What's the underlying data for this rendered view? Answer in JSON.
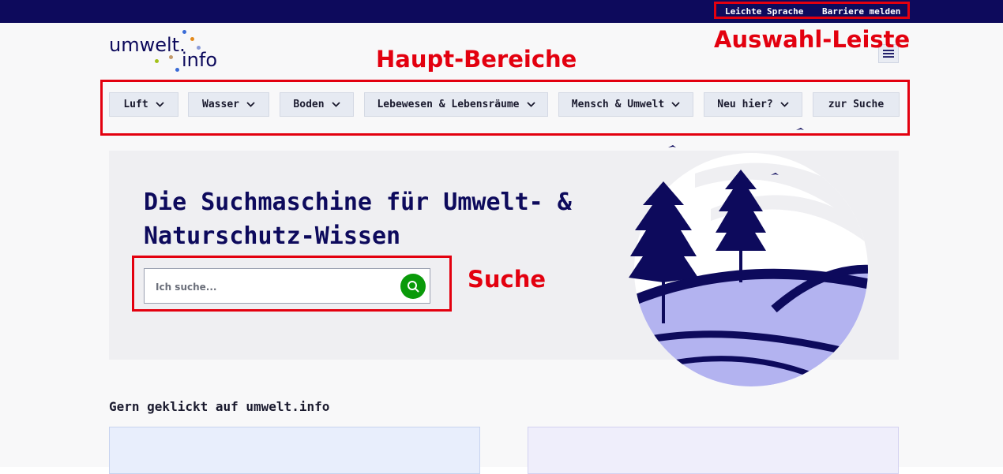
{
  "topbar": {
    "easy_language": "Leichte Sprache",
    "report_barrier": "Barriere melden"
  },
  "annotations": {
    "selection_bar": "Auswahl-Leiste",
    "main_areas": "Haupt-Bereiche",
    "search": "Suche"
  },
  "logo": {
    "word1": "umwelt.",
    "word2": "info"
  },
  "nav": {
    "items": [
      {
        "label": "Luft",
        "dropdown": true
      },
      {
        "label": "Wasser",
        "dropdown": true
      },
      {
        "label": "Boden",
        "dropdown": true
      },
      {
        "label": "Lebewesen & Lebensräume",
        "dropdown": true
      },
      {
        "label": "Mensch & Umwelt",
        "dropdown": true
      },
      {
        "label": "Neu hier?",
        "dropdown": true
      },
      {
        "label": "zur Suche",
        "dropdown": false
      }
    ]
  },
  "hero": {
    "title": "Die Suchmaschine für Umwelt- & Naturschutz-Wissen",
    "search_placeholder": "Ich suche..."
  },
  "section": {
    "title": "Gern geklickt auf umwelt.info"
  },
  "colors": {
    "brand_navy": "#0d0a5c",
    "annotation_red": "#e3000f",
    "search_green": "#0a9a0a",
    "hill_lavender": "#b3b3f0"
  },
  "icons": {
    "menu": "hamburger-menu-icon",
    "search": "search-icon",
    "dropdown": "chevron-down-icon"
  }
}
